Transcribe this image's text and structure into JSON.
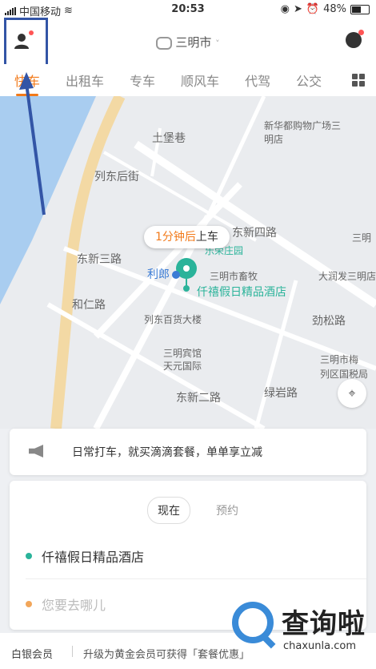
{
  "status_bar": {
    "carrier": "中国移动",
    "time": "20:53",
    "battery": "48%"
  },
  "header": {
    "city": "三明市",
    "city_arrow": "˅"
  },
  "tabs": [
    "快车",
    "出租车",
    "专车",
    "顺风车",
    "代驾",
    "公交"
  ],
  "map": {
    "pickup_eta": "1分钟后",
    "pickup_suffix": "上车",
    "labels": {
      "a": "土堡巷",
      "b": "列东后街",
      "c": "东新三路",
      "d": "和仁路",
      "e": "东新四路",
      "f": "东新二路",
      "g": "劲松路",
      "h": "绿岩路",
      "i": "新华都购物广场三明店",
      "j": "三明",
      "k": "大润发三明店",
      "l": "乐荣庄园",
      "m": "利郎",
      "n": "三明市畜牧",
      "o": "仟禧假日精品酒店",
      "p": "列东百货大楼",
      "q": "三明宾馆",
      "r": "天元国际",
      "s": "三明市梅",
      "t": "列区国税局"
    },
    "locate_icon": "⌖"
  },
  "promo": {
    "text": "日常打车，就买滴滴套餐，单单享立减"
  },
  "booking": {
    "now_label": "现在",
    "reserve_label": "预约",
    "origin": "仟禧假日精品酒店",
    "destination_placeholder": "您要去哪儿",
    "origin_color": "#2ab39a",
    "destination_color": "#f2a65a"
  },
  "member": {
    "level": "白银会员",
    "promo": "升级为黄金会员可获得「套餐优惠」"
  },
  "watermark": {
    "cn": "查询啦",
    "en": "chaxunla.com"
  },
  "colors": {
    "accent": "#f27a1a",
    "pin": "#2ab39a",
    "annotation": "#3355a6"
  }
}
